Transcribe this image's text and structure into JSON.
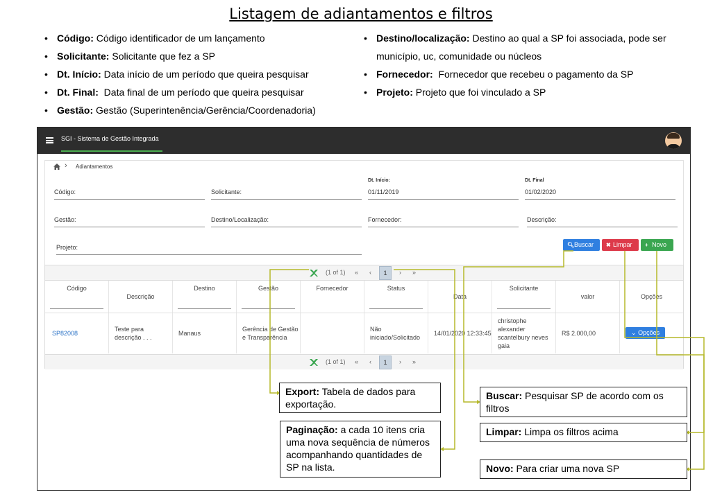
{
  "doc": {
    "title": "Listagem de adiantamentos e filtros",
    "left_bullets": [
      {
        "term": "Código:",
        "desc": " Código identificador de um lançamento"
      },
      {
        "term": "Solicitante:",
        "desc": " Solicitante que fez a SP"
      },
      {
        "term": "Dt. Início:",
        "desc": " Data início de um período que queira pesquisar"
      },
      {
        "term": "Dt. Final:",
        "desc": "  Data final de um período que queira pesquisar"
      },
      {
        "term": "Gestão:",
        "desc": " Gestão (Superintenência/Gerência/Coordenadoria)"
      }
    ],
    "right_bullets": [
      {
        "term": "Destino/localização:",
        "desc": " Destino ao qual a SP foi associada, pode ser município, uc, comunidade ou núcleos"
      },
      {
        "term": "Fornecedor:",
        "desc": "  Fornecedor que recebeu o pagamento da SP"
      },
      {
        "term": "Projeto:",
        "desc": " Projeto que foi vinculado a SP"
      }
    ]
  },
  "app": {
    "title": "SGI - Sistema de Gestão Integrada",
    "menu_icon": "hamburger-icon",
    "avatar_icon": "user-avatar-icon",
    "accent_color": "#4caf50",
    "topbar_color": "#2d2d2d"
  },
  "breadcrumb": {
    "home_icon": "home-icon",
    "separator": "›",
    "current": "Adiantamentos"
  },
  "filters": {
    "codigo": {
      "label": "Código:"
    },
    "solicitante": {
      "label": "Solicitante:"
    },
    "dt_inicio": {
      "label": "Dt. Início:",
      "value": "01/11/2019"
    },
    "dt_final": {
      "label": "Dt. Final",
      "value": "01/02/2020"
    },
    "gestao": {
      "label": "Gestão:"
    },
    "destino": {
      "label": "Destino/Localização:"
    },
    "fornecedor": {
      "label": "Fornecedor:"
    },
    "descricao": {
      "label": "Descrição:"
    },
    "projeto": {
      "label": "Projeto:"
    }
  },
  "actions": {
    "buscar": {
      "label": "Buscar",
      "icon": "search-icon",
      "color": "#2f7fe0"
    },
    "limpar": {
      "label": "Limpar",
      "icon": "trash-icon",
      "color": "#dd3a4a"
    },
    "novo": {
      "label": "Novo",
      "icon": "plus-icon",
      "color": "#3aa650"
    }
  },
  "pagination": {
    "info": "(1 of 1)",
    "first": "«",
    "prev": "‹",
    "current_page": "1",
    "next": "›",
    "last": "»",
    "export_icon": "excel-export-icon"
  },
  "table": {
    "headers": {
      "codigo": "Código",
      "descricao": "Descrição",
      "destino": "Destino",
      "gestao": "Gestão",
      "fornecedor": "Fornecedor",
      "status": "Status",
      "data": "Data",
      "solicitante": "Solicitante",
      "valor": "valor",
      "opcoes": "Opções"
    },
    "row": {
      "codigo": "SP82008",
      "descricao": "Teste para descrição . . .",
      "destino": "Manaus",
      "gestao": "Gerência de Gestão e Transparência",
      "fornecedor": "",
      "status": "Não iniciado/Solicitado",
      "data": "14/01/2020 12:33:45",
      "solicitante": "christophe alexander scantelbury neves gaia",
      "valor": "R$ 2.000,00",
      "opcoes": "Opções",
      "opcoes_icon": "chevron-down-icon"
    }
  },
  "callouts": {
    "export": {
      "term": "Export:",
      "desc": " Tabela de dados para exportação."
    },
    "paginacao": {
      "term": "Paginação:",
      "desc": " a cada 10 itens cria uma nova sequência de números acompanhando quantidades de SP na lista."
    },
    "buscar": {
      "term": "Buscar:",
      "desc": "  Pesquisar SP de acordo com os filtros"
    },
    "limpar": {
      "term": "Limpar:",
      "desc": "  Limpa os filtros acima"
    },
    "novo": {
      "term": "Novo:",
      "desc": " Para criar uma nova SP"
    },
    "connector_color": "#b5b92a"
  }
}
